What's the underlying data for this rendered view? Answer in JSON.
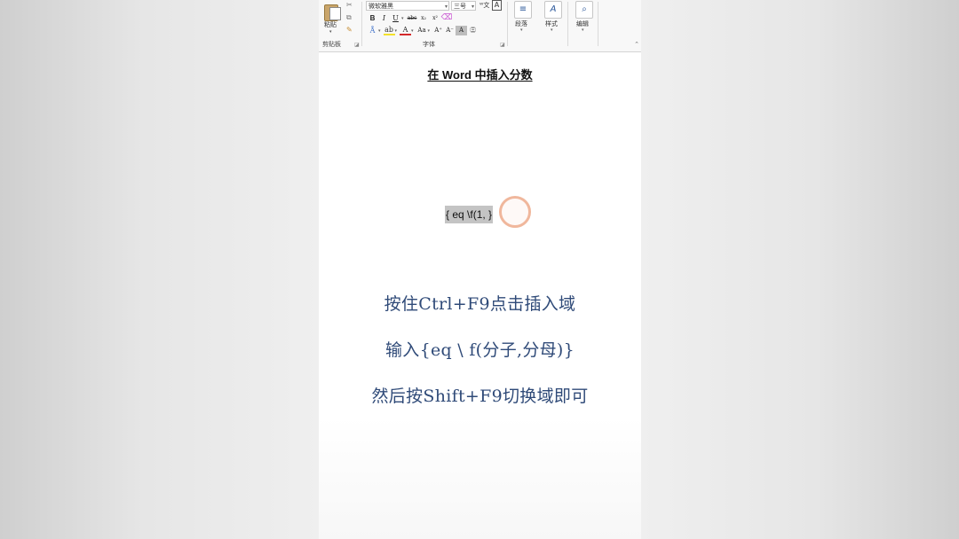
{
  "ribbon": {
    "clipboard": {
      "paste_label": "粘贴",
      "group_label": "剪贴板"
    },
    "font": {
      "font_name": "微软雅黑",
      "font_size": "三号",
      "group_label": "字体",
      "buttons": [
        "B",
        "I",
        "U",
        "abc",
        "x₂",
        "x²"
      ]
    },
    "paragraph": {
      "label": "段落"
    },
    "styles": {
      "label": "样式"
    },
    "editing": {
      "label": "编辑"
    }
  },
  "document": {
    "title": "在 Word 中插入分数",
    "field_code": "{ eq \\f(1, }"
  },
  "captions": [
    "按住Ctrl+F9点击插入域",
    "输入{eq \\ f(分子,分母)}",
    "然后按Shift+F9切换域即可"
  ],
  "colors": {
    "caption_text": "#2f4a78",
    "field_highlight": "#c4c4c4",
    "cursor_ring": "#f0b79c"
  }
}
